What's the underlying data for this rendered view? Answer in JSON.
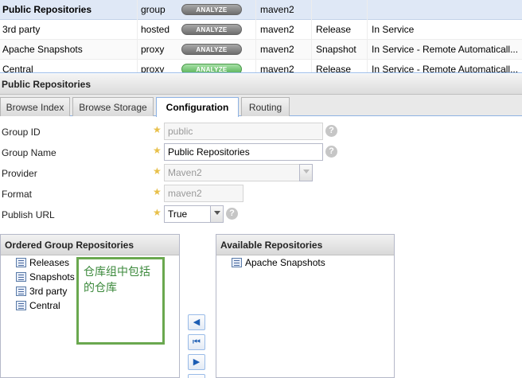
{
  "repositories": [
    {
      "name": "Public Repositories",
      "type": "group",
      "analyze": "ANALYZE",
      "format": "maven2",
      "policy": "",
      "status": "",
      "selected": true
    },
    {
      "name": "3rd party",
      "type": "hosted",
      "analyze": "ANALYZE",
      "format": "maven2",
      "policy": "Release",
      "status": "In Service"
    },
    {
      "name": "Apache Snapshots",
      "type": "proxy",
      "analyze": "ANALYZE",
      "format": "maven2",
      "policy": "Snapshot",
      "status": "In Service - Remote Automaticall..."
    },
    {
      "name": "Central",
      "type": "proxy",
      "analyze": "ANALYZE",
      "format": "maven2",
      "policy": "Release",
      "status": "In Service - Remote Automaticall..."
    }
  ],
  "panel": {
    "title": "Public Repositories"
  },
  "tabs": [
    {
      "label": "Browse Index"
    },
    {
      "label": "Browse Storage"
    },
    {
      "label": "Configuration",
      "active": true
    },
    {
      "label": "Routing"
    }
  ],
  "form": {
    "group_id": {
      "label": "Group ID",
      "value": "public"
    },
    "group_name": {
      "label": "Group Name",
      "value": "Public Repositories"
    },
    "provider": {
      "label": "Provider",
      "value": "Maven2"
    },
    "format": {
      "label": "Format",
      "value": "maven2"
    },
    "publish_url": {
      "label": "Publish URL",
      "value": "True"
    },
    "help_glyph": "?",
    "required_glyph": "★"
  },
  "ordered_group": {
    "title": "Ordered Group Repositories",
    "items": [
      "Releases",
      "Snapshots",
      "3rd party",
      "Central"
    ]
  },
  "available": {
    "title": "Available Repositories",
    "items": [
      "Apache Snapshots"
    ]
  },
  "annotation": {
    "text": "仓库组中包括的仓库"
  },
  "arrows": {
    "left": "◀",
    "first": "⏮",
    "right": "▶"
  },
  "colors": {
    "accent": "#8db2e3",
    "annotation_border": "#6aa84f",
    "annotation_text": "#3d8a3d",
    "required_star": "#e8c04a",
    "selected_row": "#dfe8f6"
  }
}
